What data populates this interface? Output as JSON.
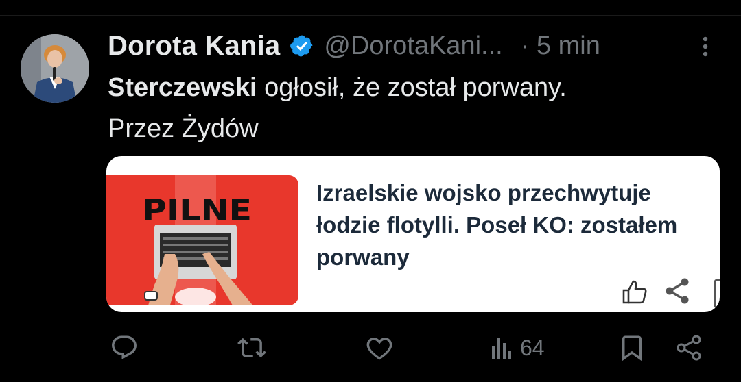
{
  "tweet": {
    "author_name": "Dorota Kania",
    "handle": "@DorotaKani...",
    "time": "· 5 min",
    "text_bold": "Sterczewski",
    "text_rest": " ogłosił, że został porwany.",
    "text_line2": "Przez Żydów"
  },
  "card": {
    "thumb_label": "PILNE",
    "headline": "Izraelskie wojsko przechwytuje łodzie flotylli. Poseł KO: zostałem porwany"
  },
  "actions": {
    "views_count": "64"
  },
  "colors": {
    "background": "#000000",
    "text": "#e7e9ea",
    "muted": "#71767b",
    "verified": "#1d9bf0",
    "card_red": "#e8372c"
  },
  "icons": [
    "verified-badge-icon",
    "more-icon",
    "thumbs-up-icon",
    "share-icon",
    "reply-icon",
    "retweet-icon",
    "like-icon",
    "views-icon",
    "bookmark-icon"
  ]
}
